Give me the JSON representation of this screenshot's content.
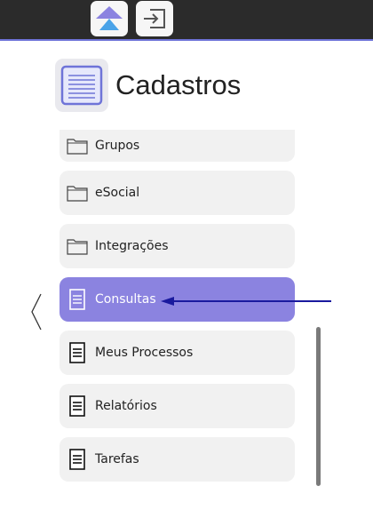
{
  "header": {
    "title": "Cadastros",
    "icon": "list-document-icon"
  },
  "toolbar": {
    "app_icon": "app-logo-icon",
    "logout_icon": "sign-in-icon"
  },
  "menu": {
    "items": [
      {
        "label": "Grupos",
        "icon": "folder-icon"
      },
      {
        "label": "eSocial",
        "icon": "folder-icon"
      },
      {
        "label": "Integrações",
        "icon": "folder-icon"
      },
      {
        "label": "Consultas",
        "icon": "document-icon",
        "active": true
      },
      {
        "label": "Meus Processos",
        "icon": "document-icon"
      },
      {
        "label": "Relatórios",
        "icon": "document-icon"
      },
      {
        "label": "Tarefas",
        "icon": "document-icon"
      }
    ]
  },
  "colors": {
    "active": "#8b83e0",
    "item_bg": "#f1f1f1",
    "topbar": "#2b2b2b",
    "annotation_arrow": "#1a1a9e"
  }
}
